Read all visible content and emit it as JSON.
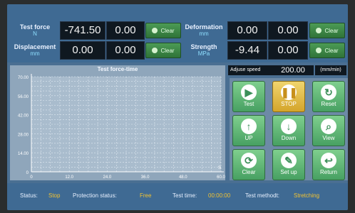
{
  "readouts": {
    "test_force": {
      "label": "Test force",
      "unit": "N",
      "value1": "-741.50",
      "value2": "0.00",
      "clear": "Clear"
    },
    "displacement": {
      "label": "Displacement",
      "unit": "mm",
      "value1": "0.00",
      "value2": "0.00",
      "clear": "Clear"
    },
    "deformation": {
      "label": "Deformation",
      "unit": "mm",
      "value1": "0.00",
      "value2": "0.00",
      "clear": "Clear"
    },
    "strength": {
      "label": "Strength",
      "unit": "MPa",
      "value1": "-9.44",
      "value2": "0.00",
      "clear": "Clear"
    }
  },
  "chart": {
    "title": "Test force-time",
    "y_ticks": [
      "70.00",
      "56.00",
      "42.00",
      "28.00",
      "14.00",
      "0"
    ],
    "x_ticks": [
      "0",
      "12.0",
      "24.0",
      "36.0",
      "48.0",
      "60.0"
    ],
    "x_axis_end_label": "S"
  },
  "chart_data": {
    "type": "line",
    "title": "Test force-time",
    "xlabel": "S",
    "ylabel": "",
    "x": [],
    "y": [],
    "xlim": [
      0,
      60
    ],
    "ylim": [
      0,
      70
    ],
    "grid": true
  },
  "speed": {
    "label": "Adjuse speed",
    "value": "200.00",
    "unit": "(mm/min)"
  },
  "buttons": {
    "test": "Test",
    "stop": "STOP",
    "reset": "Reset",
    "up": "UP",
    "down": "Down",
    "view": "View",
    "clear": "Clear",
    "setup": "Set up",
    "return": "Return"
  },
  "status": {
    "status_label": "Status:",
    "status_value": "Stop",
    "protection_label": "Protection status:",
    "protection_value": "Free",
    "time_label": "Test time:",
    "time_value": "00:00:00",
    "method_label": "Test methodt:",
    "method_value": "Stretching"
  },
  "colors": {
    "accent": "#f1c232",
    "button_green": "#58b06e",
    "button_yellow": "#e6bb3f",
    "panel": "#3f6a93"
  }
}
